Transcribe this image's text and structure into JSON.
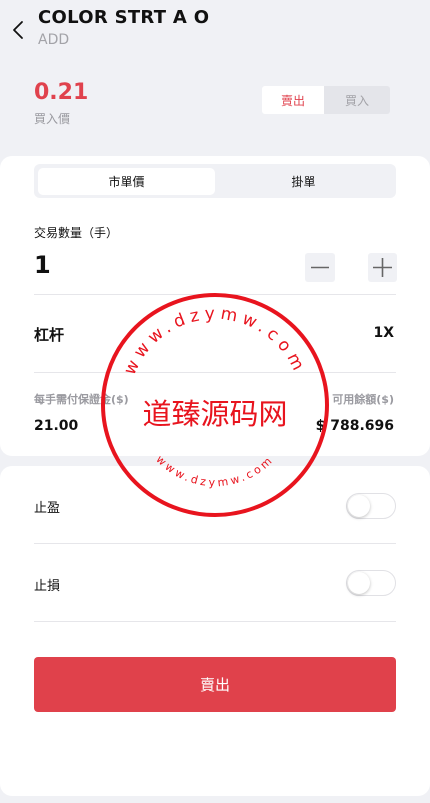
{
  "header": {
    "back_icon": "chevron-left-icon",
    "title": "COLOR STRT A O",
    "subtitle": "ADD"
  },
  "quote": {
    "price": "0.21",
    "price_label": "買入價"
  },
  "side_toggle": {
    "sell_label": "賣出",
    "buy_label": "買入",
    "selected": "sell"
  },
  "order_type_tabs": {
    "market_label": "市單價",
    "limit_label": "掛單",
    "selected": "market"
  },
  "quantity": {
    "label": "交易數量（手）",
    "value": "1",
    "minus_icon": "minus-icon",
    "plus_icon": "plus-icon"
  },
  "leverage": {
    "label": "杠杆",
    "value": "1X"
  },
  "margin": {
    "required_label": "每手需付保證金($)",
    "required_value": "21.00",
    "available_label": "可用餘額($)",
    "available_value": "$ 788.696"
  },
  "take_profit": {
    "label": "止盈",
    "enabled": false
  },
  "stop_loss": {
    "label": "止損",
    "enabled": false
  },
  "submit": {
    "label": "賣出"
  },
  "watermark": {
    "top_text": "www.dzymw.com",
    "center_text": "道臻源码网",
    "bottom_text": "www.dzymw.com"
  },
  "colors": {
    "accent_red": "#e0424d",
    "background": "#f0f1f5",
    "card": "#ffffff",
    "muted_text": "#9a9aa0",
    "stamp_red": "#e8141e"
  }
}
